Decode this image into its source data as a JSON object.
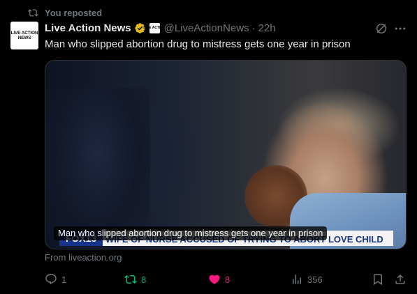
{
  "repost": {
    "label": "You reposted",
    "icon": "repost-icon"
  },
  "author": {
    "avatar_text": "LIVE ACTION NEWS",
    "name": "Live Action News",
    "verified_icon": "gold-verified-badge-icon",
    "affiliate_badge_text": "LIVE ACTION",
    "handle": "@LiveActionNews",
    "separator": "·",
    "time": "22h"
  },
  "tweet": {
    "text": "Man who slipped abortion drug to mistress gets one year in prison"
  },
  "media": {
    "caption": "Man who slipped abortion drug to mistress gets one year in prison",
    "chyron_station": "FOX13",
    "chyron_headline": "WIFE OF NURSE ACCUSED OF TRYING TO ABORT LOVE CHILD CHARGED",
    "chyron_corner": "FOX 13"
  },
  "source": "From liveaction.org",
  "actions": {
    "reply_count": "1",
    "retweet_count": "8",
    "like_count": "8",
    "views_count": "356"
  },
  "colors": {
    "background": "#000000",
    "text": "#e7e9ea",
    "muted": "#71767b",
    "retweet_active": "#00ba7c",
    "like_active": "#f91880",
    "verified_gold": "#e2b719"
  }
}
